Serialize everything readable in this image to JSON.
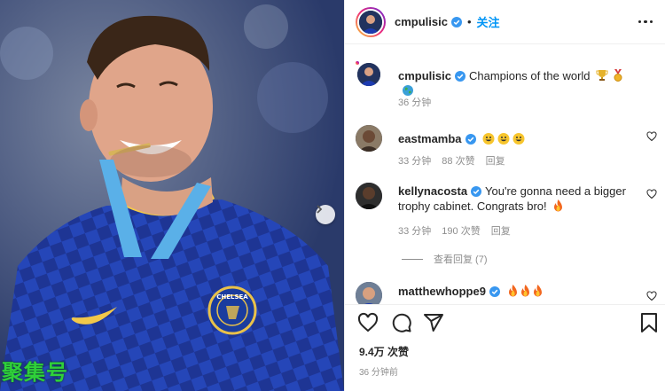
{
  "post": {
    "author": "cmpulisic",
    "follow_label": "关注",
    "caption": "Champions of the world",
    "caption_time": "36 分钟",
    "likes": "9.4万 次赞",
    "time_ago": "36 分钟前",
    "watermark": "聚集号"
  },
  "comments": [
    {
      "user": "eastmamba",
      "text": "",
      "emoji_count": 3,
      "time": "33 分钟",
      "likes": "88 次赞",
      "reply": "回复"
    },
    {
      "user": "kellynacosta",
      "text": "You're gonna need a bigger trophy cabinet. Congrats bro!",
      "time": "33 分钟",
      "likes": "190 次赞",
      "reply": "回复",
      "view_replies": "查看回复 (7)"
    },
    {
      "user": "matthewhoppe9",
      "text": ""
    }
  ],
  "colors": {
    "link": "#0095f6",
    "verified": "#3897f0",
    "watermark": "#2fd03a",
    "shirt": "#1b2f8f"
  },
  "icons": [
    "verified-badge-icon",
    "more-options-icon",
    "heart-icon",
    "comment-icon",
    "share-icon",
    "bookmark-icon",
    "chevron-right-icon",
    "trophy-icon",
    "medal-icon",
    "globe-icon",
    "grin-emoji-icon",
    "fire-icon"
  ]
}
